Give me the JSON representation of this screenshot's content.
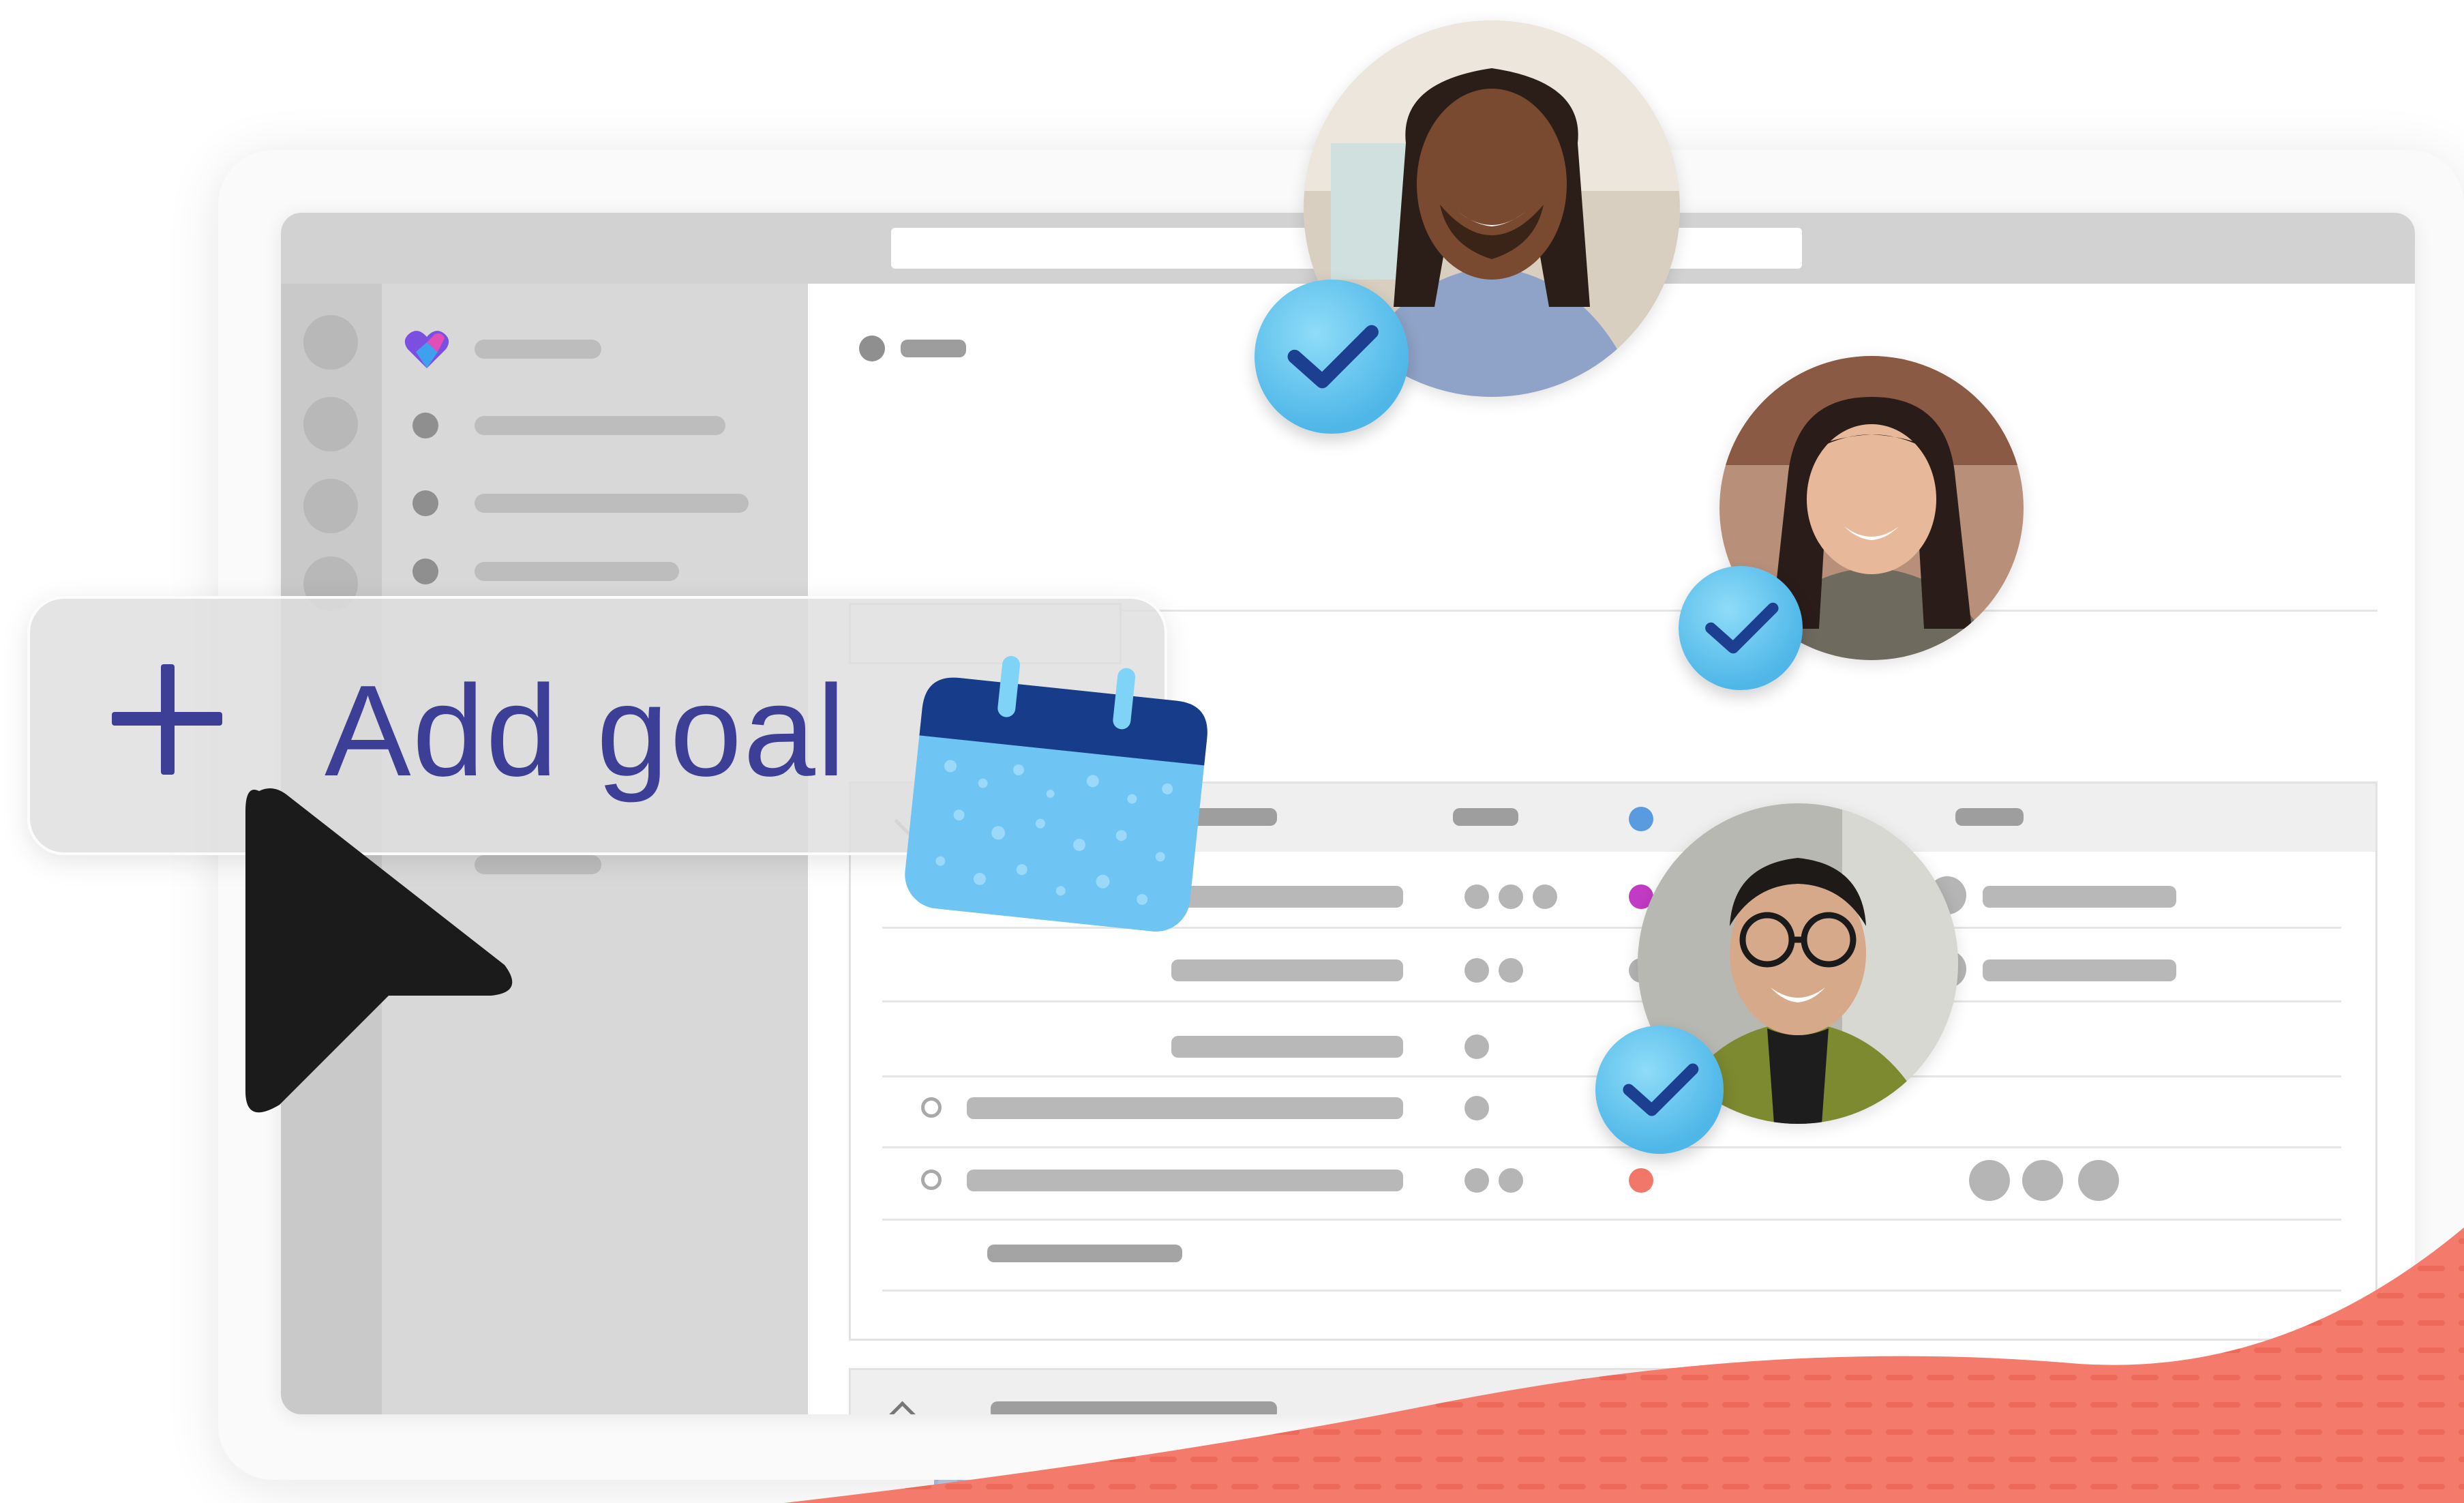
{
  "overlay": {
    "add_goal_label": "Add goal",
    "plus_icon": "plus-icon"
  },
  "colors": {
    "accent": "#3c3f95",
    "check_badge": "#4fb7e8",
    "status_blue": "#4a90d9",
    "status_magenta": "#c23bc4",
    "status_navy": "#2f3aa8",
    "status_red": "#f0776a",
    "wave_coral": "#f47a6b"
  },
  "icons": {
    "app_logo": "viva-goals-logo",
    "cursor": "pointer-cursor-icon",
    "calendar": "calendar-icon",
    "check": "checkmark-icon",
    "chevron": "chevron-up-icon"
  },
  "people": [
    {
      "name": "avatar-person-1"
    },
    {
      "name": "avatar-person-2"
    },
    {
      "name": "avatar-person-3"
    }
  ]
}
